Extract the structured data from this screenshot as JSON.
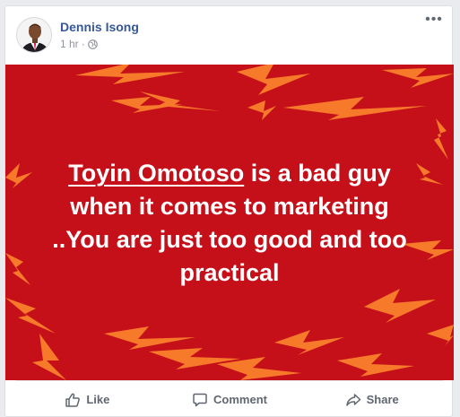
{
  "post": {
    "author": "Dennis Isong",
    "time": "1 hr",
    "separator": "·",
    "more_label": "•••",
    "text_mention": "Toyin Omotoso",
    "text_rest_line1": " is a bad guy",
    "text_line2": "when it comes to marketing",
    "text_line3": "..You are just too good and too",
    "text_line4": "practical"
  },
  "actions": {
    "like": "Like",
    "comment": "Comment",
    "share": "Share"
  },
  "colors": {
    "background_red": "#c5101a",
    "bolt_orange": "#f7792a",
    "link_blue": "#365899"
  }
}
